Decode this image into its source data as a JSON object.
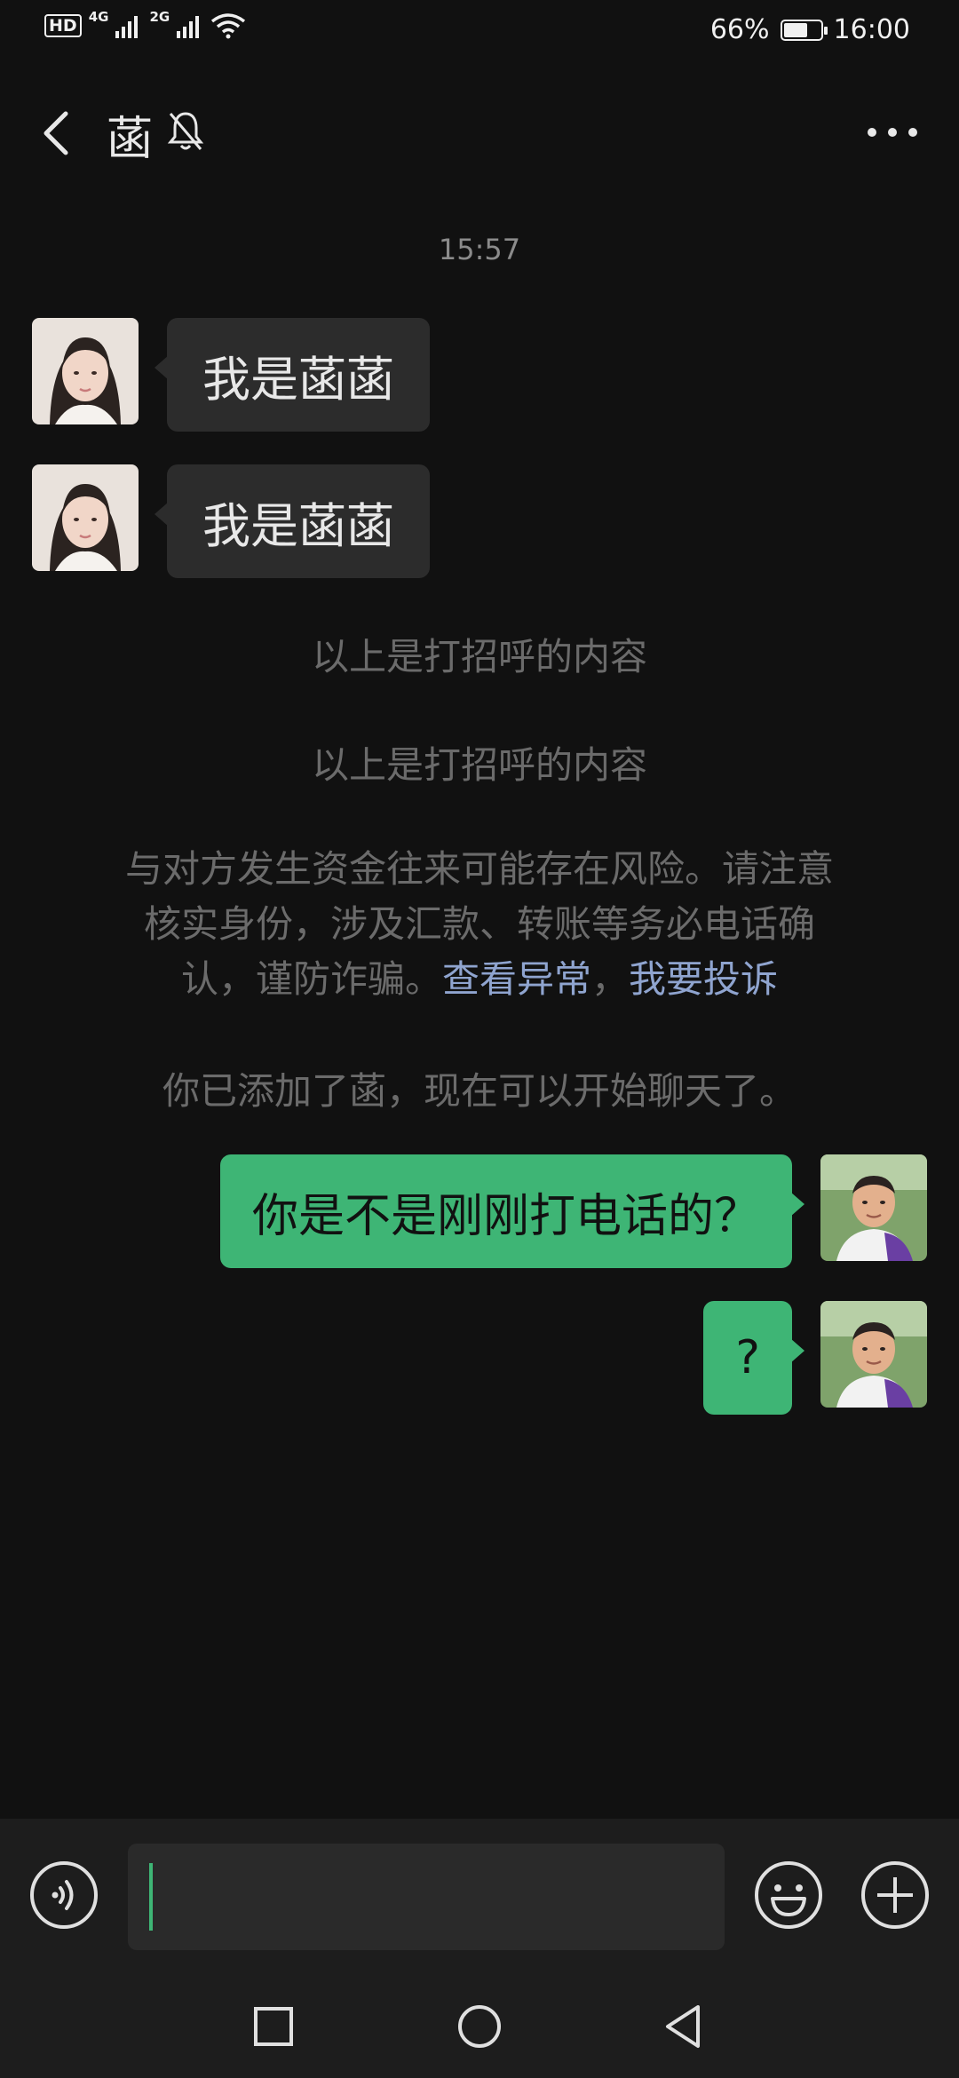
{
  "status_bar": {
    "hd_label": "HD",
    "net1": "4G",
    "net2": "2G",
    "battery_text": "66%",
    "battery_level": 0.66,
    "time": "16:00"
  },
  "header": {
    "title": "菡",
    "mute_icon": "bell-off-icon",
    "more_icon": "more-dots-icon",
    "back_icon": "chevron-left-icon"
  },
  "chat": {
    "timestamp": "15:57",
    "incoming_messages": [
      {
        "text": "我是菡菡"
      },
      {
        "text": "我是菡菡"
      }
    ],
    "system_greeting_1": "以上是打招呼的内容",
    "system_greeting_2": "以上是打招呼的内容",
    "risk_notice": {
      "line1": "与对方发生资金往来可能存在风险。请注意",
      "line2": "核实身份，涉及汇款、转账等务必电话确",
      "line3_prefix": "认，谨防诈骗。",
      "link_view": "查看异常",
      "separator": "，",
      "link_report": "我要投诉"
    },
    "added_notice": "你已添加了菡，现在可以开始聊天了。",
    "outgoing_messages": [
      {
        "text": "你是不是刚刚打电话的？"
      },
      {
        "text": "?"
      }
    ]
  },
  "input_bar": {
    "voice_icon": "voice-icon",
    "emoji_icon": "emoji-icon",
    "plus_icon": "plus-icon",
    "text_value": ""
  },
  "nav_bar": {
    "recents_icon": "square-icon",
    "home_icon": "circle-icon",
    "back_icon": "triangle-back-icon"
  },
  "colors": {
    "background": "#111111",
    "incoming_bubble": "#2c2c2c",
    "outgoing_bubble": "#3eb575",
    "link": "#8fa4cf",
    "system_text": "#6b6b6b"
  }
}
